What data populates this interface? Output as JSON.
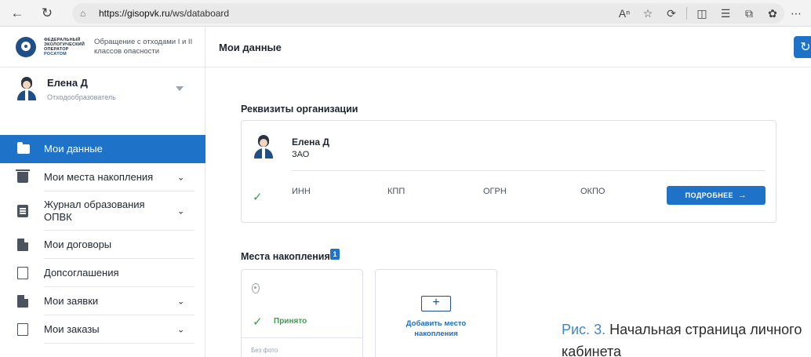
{
  "browser": {
    "url_host": "https://gisopvk.ru",
    "url_path": "/ws/databoard"
  },
  "logo": {
    "line1": "ФЕДЕРАЛЬНЫЙ",
    "line2": "ЭКОЛОГИЧЕСКИЙ",
    "line3": "ОПЕРАТОР",
    "line4": "РОСАТОМ",
    "description": "Обращение с отходами I и II классов опасности"
  },
  "header": {
    "title": "Мои данные"
  },
  "user": {
    "name": "Елена Д",
    "role": "Отходообразователь"
  },
  "menu": [
    {
      "label": "Мои данные"
    },
    {
      "label": "Мои места накопления"
    },
    {
      "label": "Журнал образования ОПВК"
    },
    {
      "label": "Мои договоры"
    },
    {
      "label": "Допсоглашения"
    },
    {
      "label": "Мои заявки"
    },
    {
      "label": "Мои заказы"
    }
  ],
  "org": {
    "section_title": "Реквизиты организации",
    "name": "Елена Д",
    "type": "ЗАО",
    "fields": [
      "ИНН",
      "КПП",
      "ОГРН",
      "ОКПО"
    ],
    "details_button": "ПОДРОБНЕЕ"
  },
  "places": {
    "section_title": "Места накопления",
    "count": "1",
    "status": "Принято",
    "photo": "Без фото",
    "add_label": "Добавить место накопления"
  },
  "caption": {
    "prefix": "Рис. 3.",
    "text": "Начальная страница личного кабинета"
  },
  "colors": {
    "accent": "#1e73c8",
    "brand": "#1f4f86",
    "success": "#3aa14a"
  }
}
